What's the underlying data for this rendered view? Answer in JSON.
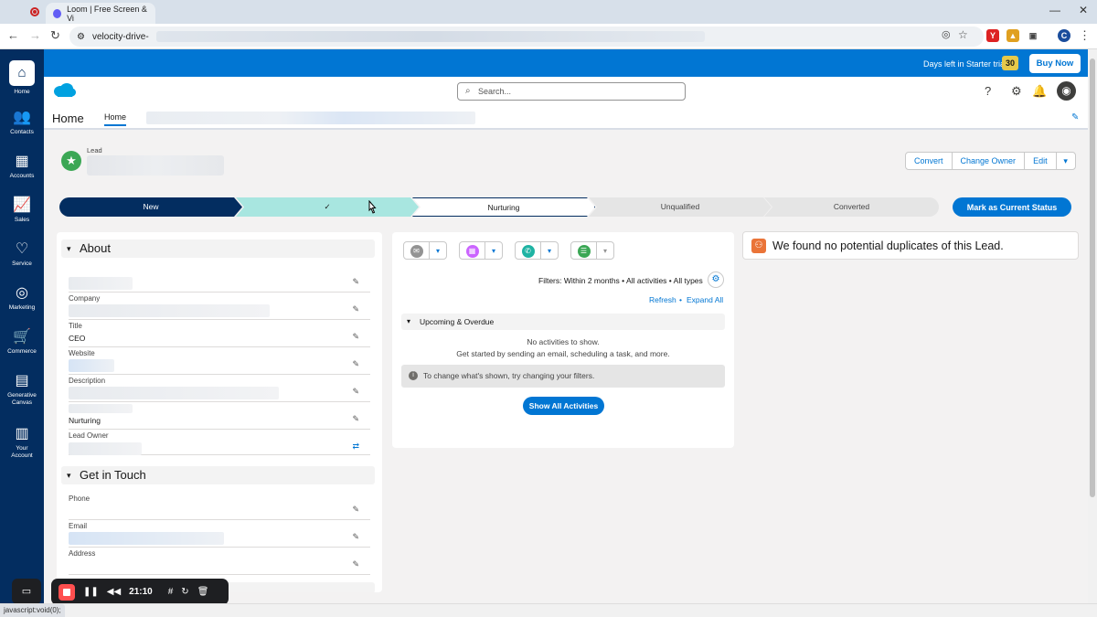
{
  "browser": {
    "tab_title": "Loom | Free Screen & Vi",
    "url": "velocity-drive-"
  },
  "nav": {
    "items": [
      {
        "label": "Home",
        "icon": "home-icon"
      },
      {
        "label": "Contacts",
        "icon": "contacts-icon"
      },
      {
        "label": "Accounts",
        "icon": "accounts-icon"
      },
      {
        "label": "Sales",
        "icon": "sales-icon"
      },
      {
        "label": "Service",
        "icon": "service-icon"
      },
      {
        "label": "Marketing",
        "icon": "marketing-icon"
      },
      {
        "label": "Commerce",
        "icon": "commerce-icon"
      },
      {
        "label": "Generative Canvas",
        "icon": "canvas-icon"
      },
      {
        "label": "Your Account",
        "icon": "account-icon"
      }
    ]
  },
  "banner": {
    "trial_text": "Days left in Starter trial:",
    "trial_count": "30",
    "buy_now": "Buy Now"
  },
  "header": {
    "search_placeholder": "Search...",
    "app_name": "Home",
    "home_tab": "Home"
  },
  "record": {
    "object_label": "Lead",
    "actions": {
      "convert": "Convert",
      "change_owner": "Change Owner",
      "edit": "Edit"
    }
  },
  "path": {
    "steps": [
      "New",
      "",
      "Nurturing",
      "Unqualified",
      "Converted"
    ],
    "mark_button": "Mark as Current Status"
  },
  "details": {
    "about_title": "About",
    "fields": [
      {
        "label": "Company",
        "value": ""
      },
      {
        "label": "Title",
        "value": "CEO"
      },
      {
        "label": "Website",
        "value": ""
      },
      {
        "label": "Description",
        "value": ""
      },
      {
        "label": "Lead Owner",
        "value": ""
      }
    ],
    "status_value": "Nurturing",
    "get_in_touch_title": "Get in Touch",
    "contact_fields": [
      {
        "label": "Phone",
        "value": ""
      },
      {
        "label": "Email",
        "value": ""
      },
      {
        "label": "Address",
        "value": ""
      }
    ]
  },
  "activity": {
    "filters": "Filters: Within 2 months • All activities • All types",
    "refresh": "Refresh",
    "separator": "•",
    "expand_all": "Expand All",
    "upcoming": "Upcoming & Overdue",
    "no_activities": "No activities to show.",
    "get_started": "Get started by sending an email, scheduling a task, and more.",
    "change_hint": "To change what's shown, try changing your filters.",
    "show_all": "Show All Activities"
  },
  "duplicates": {
    "message": "We found no potential duplicates of this Lead."
  },
  "loom": {
    "timer": "21:10"
  },
  "status_bar": {
    "text": "javascript:void(0);"
  },
  "colors": {
    "nav_bg": "#032d60",
    "brand_blue": "#0176d3",
    "path_new": "#032d60",
    "path_complete": "#a8e6e0"
  }
}
